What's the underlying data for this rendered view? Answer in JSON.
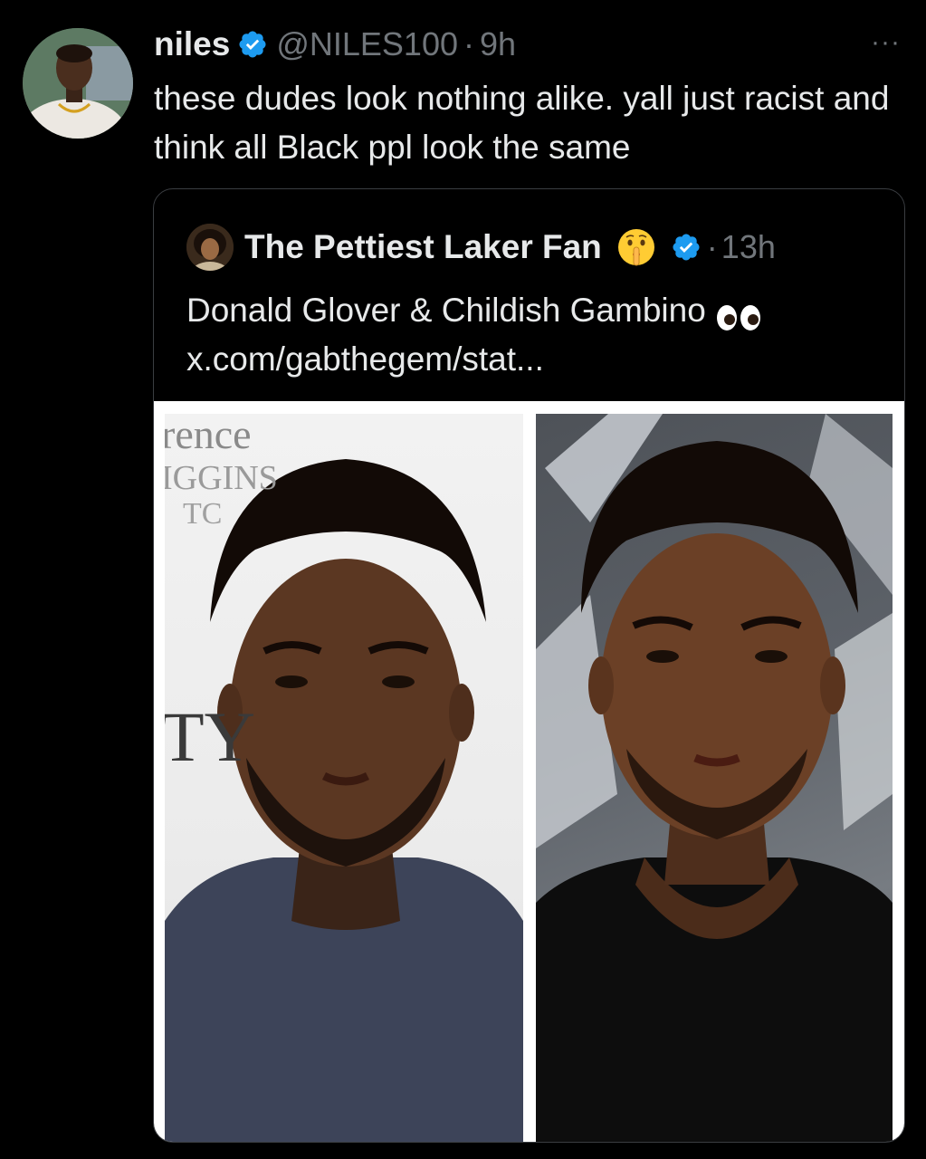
{
  "tweet": {
    "author_name": "niles",
    "author_handle": "@NILES100",
    "separator": "·",
    "time": "9h",
    "text": "these dudes look nothing alike. yall just racist and think all Black ppl look the same",
    "more_label": "···"
  },
  "quoted_tweet": {
    "author_name": "The Pettiest Laker Fan",
    "name_emoji": "shushing-face",
    "separator": "·",
    "time": "13h",
    "text": "Donald Glover & Childish Gambino",
    "text_emoji": "eyes",
    "link": "x.com/gabthegem/stat..."
  },
  "media": {
    "left_photo_backdrop_text": [
      "rence",
      "IGGINS",
      "TC",
      "TY"
    ]
  },
  "colors": {
    "background": "#000000",
    "text_primary": "#e7e9ea",
    "text_secondary": "#71767b",
    "verified_blue": "#1d9bf0",
    "border": "#3a3d41"
  },
  "icons": {
    "verified": "verified-badge-icon",
    "more": "more-horizontal-icon"
  }
}
